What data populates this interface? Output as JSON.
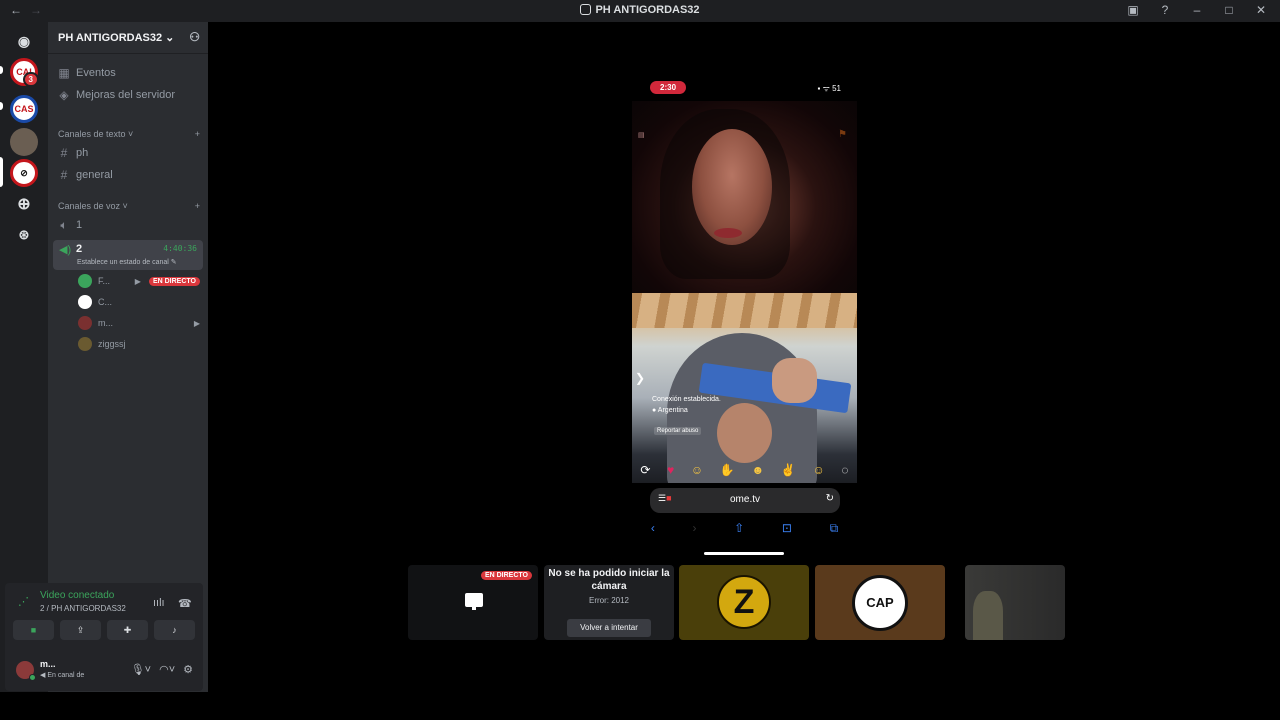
{
  "titlebar": {
    "title": "PH ANTIGORDAS32",
    "back_icon": "←",
    "forward_icon": "→"
  },
  "guilds": {
    "badge_count": "3"
  },
  "server": {
    "name": "PH ANTIGORDAS32",
    "chevron": "⌄",
    "events": "Eventos",
    "boosts": "Mejoras del servidor",
    "text_category": "Canales de texto",
    "text_channels": [
      "ph",
      "general"
    ],
    "voice_category": "Canales de voz",
    "voice_channels": [
      "1",
      "2"
    ],
    "active_channel_time": "4:40:36",
    "active_channel_status": "Establece un estado de canal",
    "users": [
      {
        "name": "F...",
        "live": "EN DIRECTO"
      },
      {
        "name": "C..."
      },
      {
        "name": "m..."
      },
      {
        "name": "ziggssj"
      }
    ]
  },
  "voice_panel": {
    "status": "Video conectado",
    "location": "2 / PH ANTIGORDAS32"
  },
  "user_panel": {
    "name": "m...",
    "status": "En canal de"
  },
  "phone": {
    "time": "2:30",
    "status_icons": "▪ ᯤ 51",
    "overlay_connection": "Conexión establecida.",
    "overlay_country": "Argentina",
    "overlay_report": "Reportar abuso",
    "url": "ome.tv"
  },
  "tiles": {
    "live_label": "EN DIRECTO",
    "error_title": "No se ha podido iniciar la cámara",
    "error_code": "Error: 2012",
    "retry_label": "Volver a intentar",
    "logo_z": "Z",
    "logo_cap": "CAP"
  }
}
